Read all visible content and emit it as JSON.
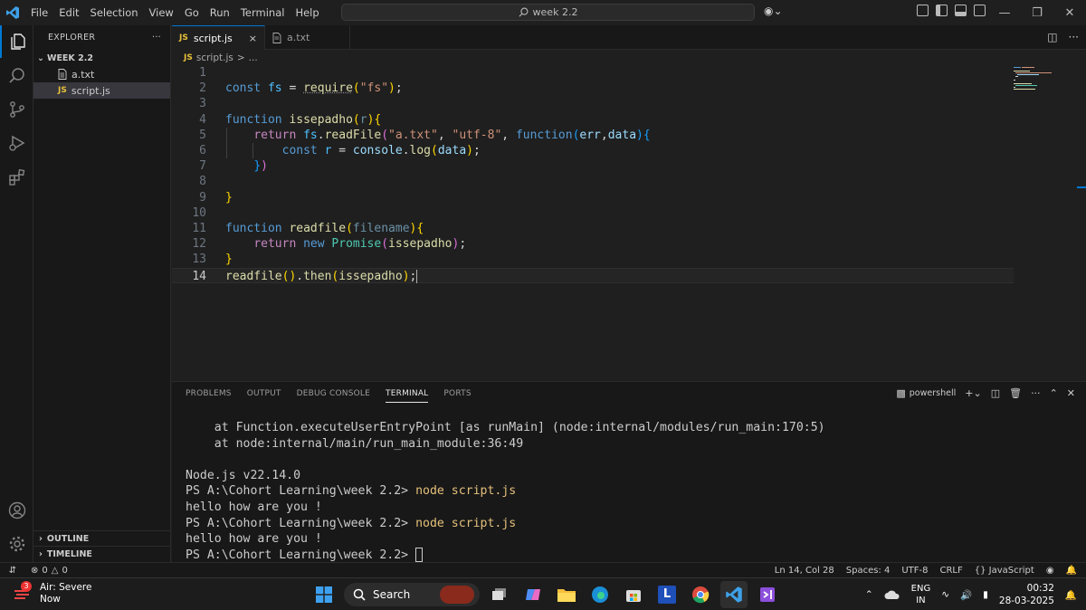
{
  "titlebar": {
    "menu": [
      "File",
      "Edit",
      "Selection",
      "View",
      "Go",
      "Run",
      "Terminal",
      "Help"
    ],
    "search_text": "week 2.2"
  },
  "sidebar": {
    "header": "EXPLORER",
    "more": "···",
    "folder": "WEEK 2.2",
    "files": [
      {
        "name": "a.txt",
        "icon": "text-file-icon"
      },
      {
        "name": "script.js",
        "badge": "JS"
      }
    ],
    "outline": "OUTLINE",
    "timeline": "TIMELINE"
  },
  "tabs": [
    {
      "label": "script.js",
      "badge": "JS",
      "close": "×"
    },
    {
      "label": "a.txt"
    }
  ],
  "breadcrumb": {
    "badge": "JS",
    "file": "script.js",
    "sep": ">",
    "rest": "..."
  },
  "editor": {
    "line_numbers": [
      "1",
      "2",
      "3",
      "4",
      "5",
      "6",
      "7",
      "8",
      "9",
      "10",
      "11",
      "12",
      "13",
      "14"
    ]
  },
  "panel": {
    "tabs": [
      "PROBLEMS",
      "OUTPUT",
      "DEBUG CONSOLE",
      "TERMINAL",
      "PORTS"
    ],
    "active_tab": "TERMINAL",
    "shell": "powershell",
    "terminal_lines": [
      "    at Function.executeUserEntryPoint [as runMain] (node:internal/modules/run_main:170:5)",
      "    at node:internal/main/run_main_module:36:49",
      "",
      "Node.js v22.14.0"
    ],
    "prompt": "PS A:\\Cohort Learning\\week 2.2> ",
    "command": "node script.js",
    "output": "hello how are you !"
  },
  "statusbar": {
    "errors": "0",
    "warnings": "0",
    "position": "Ln 14, Col 28",
    "spaces": "Spaces: 4",
    "encoding": "UTF-8",
    "eol": "CRLF",
    "language": "JavaScript"
  },
  "taskbar": {
    "weather_badge": "3",
    "weather_title": "Air: Severe",
    "weather_sub": "Now",
    "search": "Search",
    "lang_top": "ENG",
    "lang_bottom": "IN",
    "time": "00:32",
    "date": "28-03-2025"
  },
  "colors": {
    "accent": "#0078d4",
    "editor_bg": "#1f1f1f",
    "sidebar_bg": "#181818"
  }
}
